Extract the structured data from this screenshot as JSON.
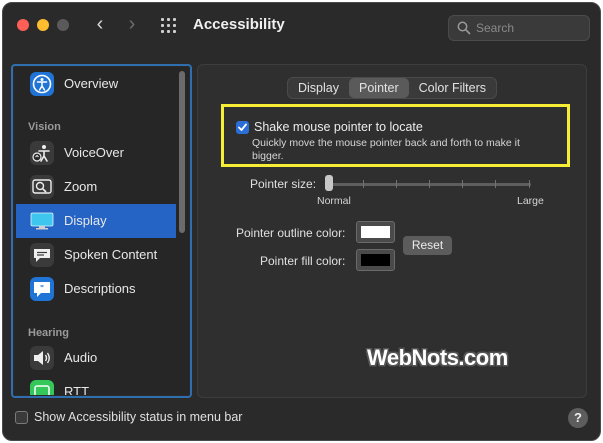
{
  "window": {
    "title": "Accessibility"
  },
  "search": {
    "placeholder": "Search"
  },
  "sidebar": {
    "sections": {
      "vision": "Vision",
      "hearing": "Hearing"
    },
    "items": [
      {
        "label": "Overview",
        "icon": "accessibility-icon"
      },
      {
        "label": "VoiceOver",
        "icon": "voiceover-icon"
      },
      {
        "label": "Zoom",
        "icon": "zoom-icon"
      },
      {
        "label": "Display",
        "icon": "display-icon",
        "selected": true
      },
      {
        "label": "Spoken Content",
        "icon": "speech-bubble-icon"
      },
      {
        "label": "Descriptions",
        "icon": "descriptions-icon"
      },
      {
        "label": "Audio",
        "icon": "speaker-icon"
      },
      {
        "label": "RTT",
        "icon": "rtt-icon"
      }
    ]
  },
  "tabs": [
    {
      "label": "Display",
      "active": false
    },
    {
      "label": "Pointer",
      "active": true
    },
    {
      "label": "Color Filters",
      "active": false
    }
  ],
  "pointer": {
    "shake_label": "Shake mouse pointer to locate",
    "shake_checked": true,
    "shake_description": "Quickly move the mouse pointer back and forth to make it bigger.",
    "size_label": "Pointer size:",
    "size_min_label": "Normal",
    "size_max_label": "Large",
    "size_value": 0,
    "outline_label": "Pointer outline color:",
    "outline_color": "#ffffff",
    "fill_label": "Pointer fill color:",
    "fill_color": "#000000",
    "reset_label": "Reset"
  },
  "watermark": "WebNots.com",
  "footer": {
    "status_label": "Show Accessibility status in menu bar",
    "status_checked": false,
    "help_label": "?"
  },
  "colors": {
    "accent": "#2563c5",
    "highlight": "#f6ee35",
    "window_bg": "#2a2a2a"
  }
}
